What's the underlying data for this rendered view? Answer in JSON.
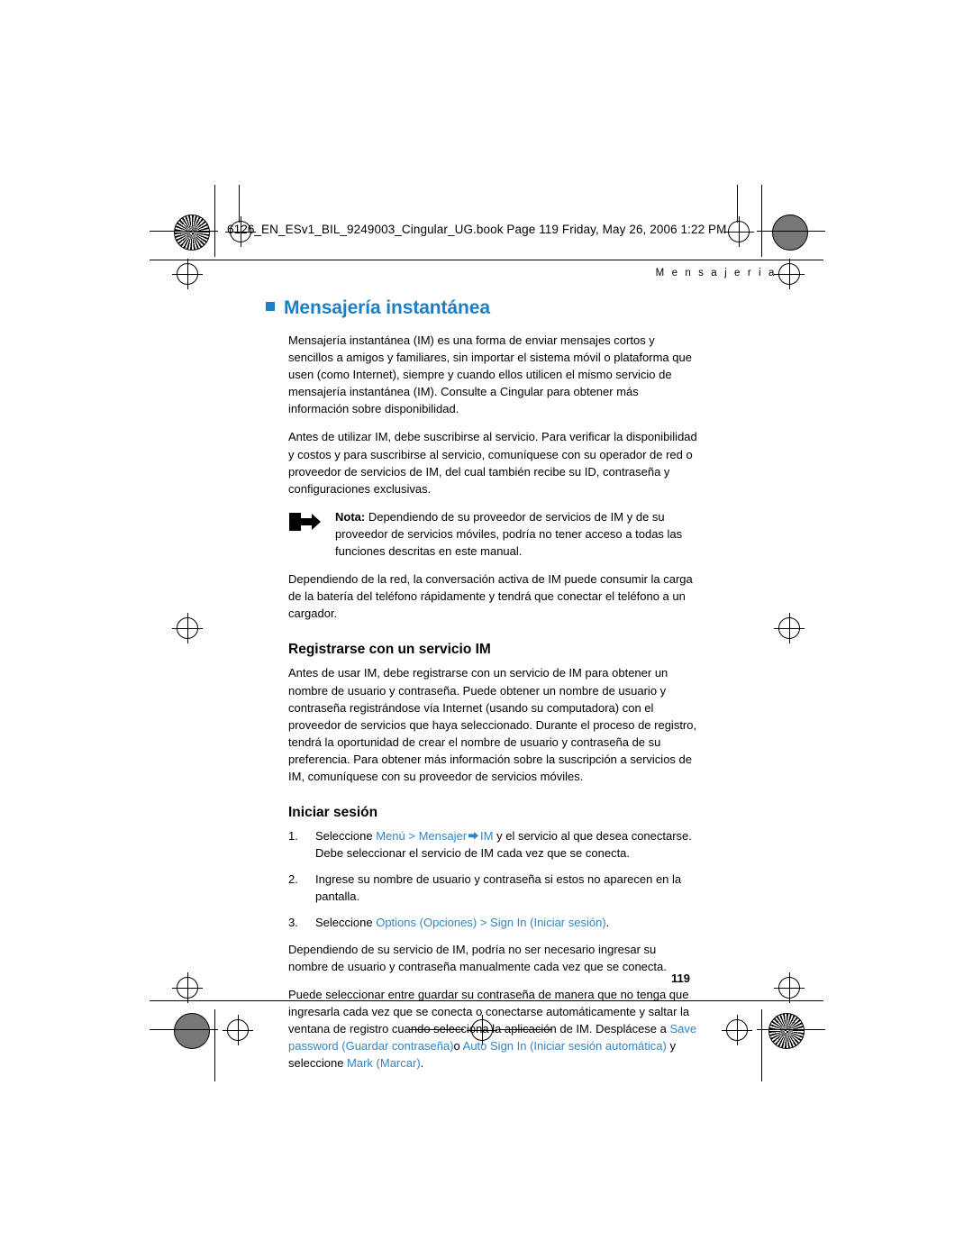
{
  "page": {
    "header_line": "6126_EN_ESv1_BIL_9249003_Cingular_UG.book  Page 119  Friday, May 26, 2006  1:22 PM",
    "running_head": "M e n s a j e r i a",
    "page_number": "119",
    "accent_color": "#1c7ec4",
    "link_color": "#2f86c7"
  },
  "chapter": {
    "title": "Mensajería instantánea",
    "intro_1": "Mensajería instantánea (IM) es una forma de enviar mensajes cortos y sencillos a amigos y familiares, sin importar el sistema móvil o plataforma que usen (como Internet), siempre y cuando ellos utilicen el mismo servicio de mensajería instantánea (IM). Consulte a Cingular para obtener más información sobre disponibilidad.",
    "intro_2": "Antes de utilizar IM, debe suscribirse al servicio. Para verificar la disponibilidad y costos y para suscribirse al servicio, comuníquese con su operador de red o proveedor de servicios de IM, del cual también recibe su ID, contraseña y configuraciones exclusivas.",
    "note_label": "Nota:",
    "note_text": " Dependiendo de su proveedor de servicios de IM y de su proveedor de servicios móviles, podría no tener acceso a todas las funciones descritas en este manual.",
    "intro_3": "Dependiendo de la red, la conversación activa de IM puede consumir la carga de la batería del teléfono rápidamente y tendrá que conectar el teléfono a un cargador."
  },
  "section_register": {
    "title": "Registrarse con un servicio IM",
    "paragraph": "Antes de usar IM, debe registrarse con un servicio de IM para obtener un nombre de usuario y contraseña. Puede obtener un nombre de usuario y contraseña registrándose vía Internet (usando su computadora) con el proveedor de servicios que haya seleccionado. Durante el proceso de registro, tendrá la oportunidad de crear el nombre de usuario y contraseña de su preferencia. Para obtener más información sobre la suscripción a servicios de IM, comuníquese con su proveedor de servicios móviles."
  },
  "section_signin": {
    "title": "Iniciar sesión",
    "steps": [
      {
        "num": "1.",
        "pre": "Seleccione ",
        "link1": "Menú",
        "sep1": " > ",
        "link2": "Mensajer",
        "link3": "IM",
        "post": " y el servicio al que desea conectarse. Debe seleccionar el servicio de IM cada vez que se conecta."
      },
      {
        "num": "2.",
        "text": "Ingrese su nombre de usuario y contraseña si estos no aparecen en la pantalla."
      },
      {
        "num": "3.",
        "pre": "Seleccione ",
        "link1": "Options (Opciones)",
        "sep1": " > ",
        "link2": "Sign In (Iniciar sesión)",
        "post": "."
      }
    ],
    "after_1": "Dependiendo de su servicio de IM, podría no ser necesario ingresar su nombre de usuario y contraseña manualmente cada vez que se conecta.",
    "after_2_a": "Puede seleccionar entre guardar su contraseña de manera que no tenga que ingresarla cada vez que se conecta o conectarse automáticamente y saltar la ventana de registro cuando selecciona la aplicación de IM. Desplácese a ",
    "after_2_link1": "Save password (Guardar contraseña)",
    "after_2_b": "o ",
    "after_2_link2": "Auto Sign In (Iniciar sesión automática)",
    "after_2_c": " y seleccione ",
    "after_2_link3": "Mark (Marcar)",
    "after_2_d": "."
  }
}
